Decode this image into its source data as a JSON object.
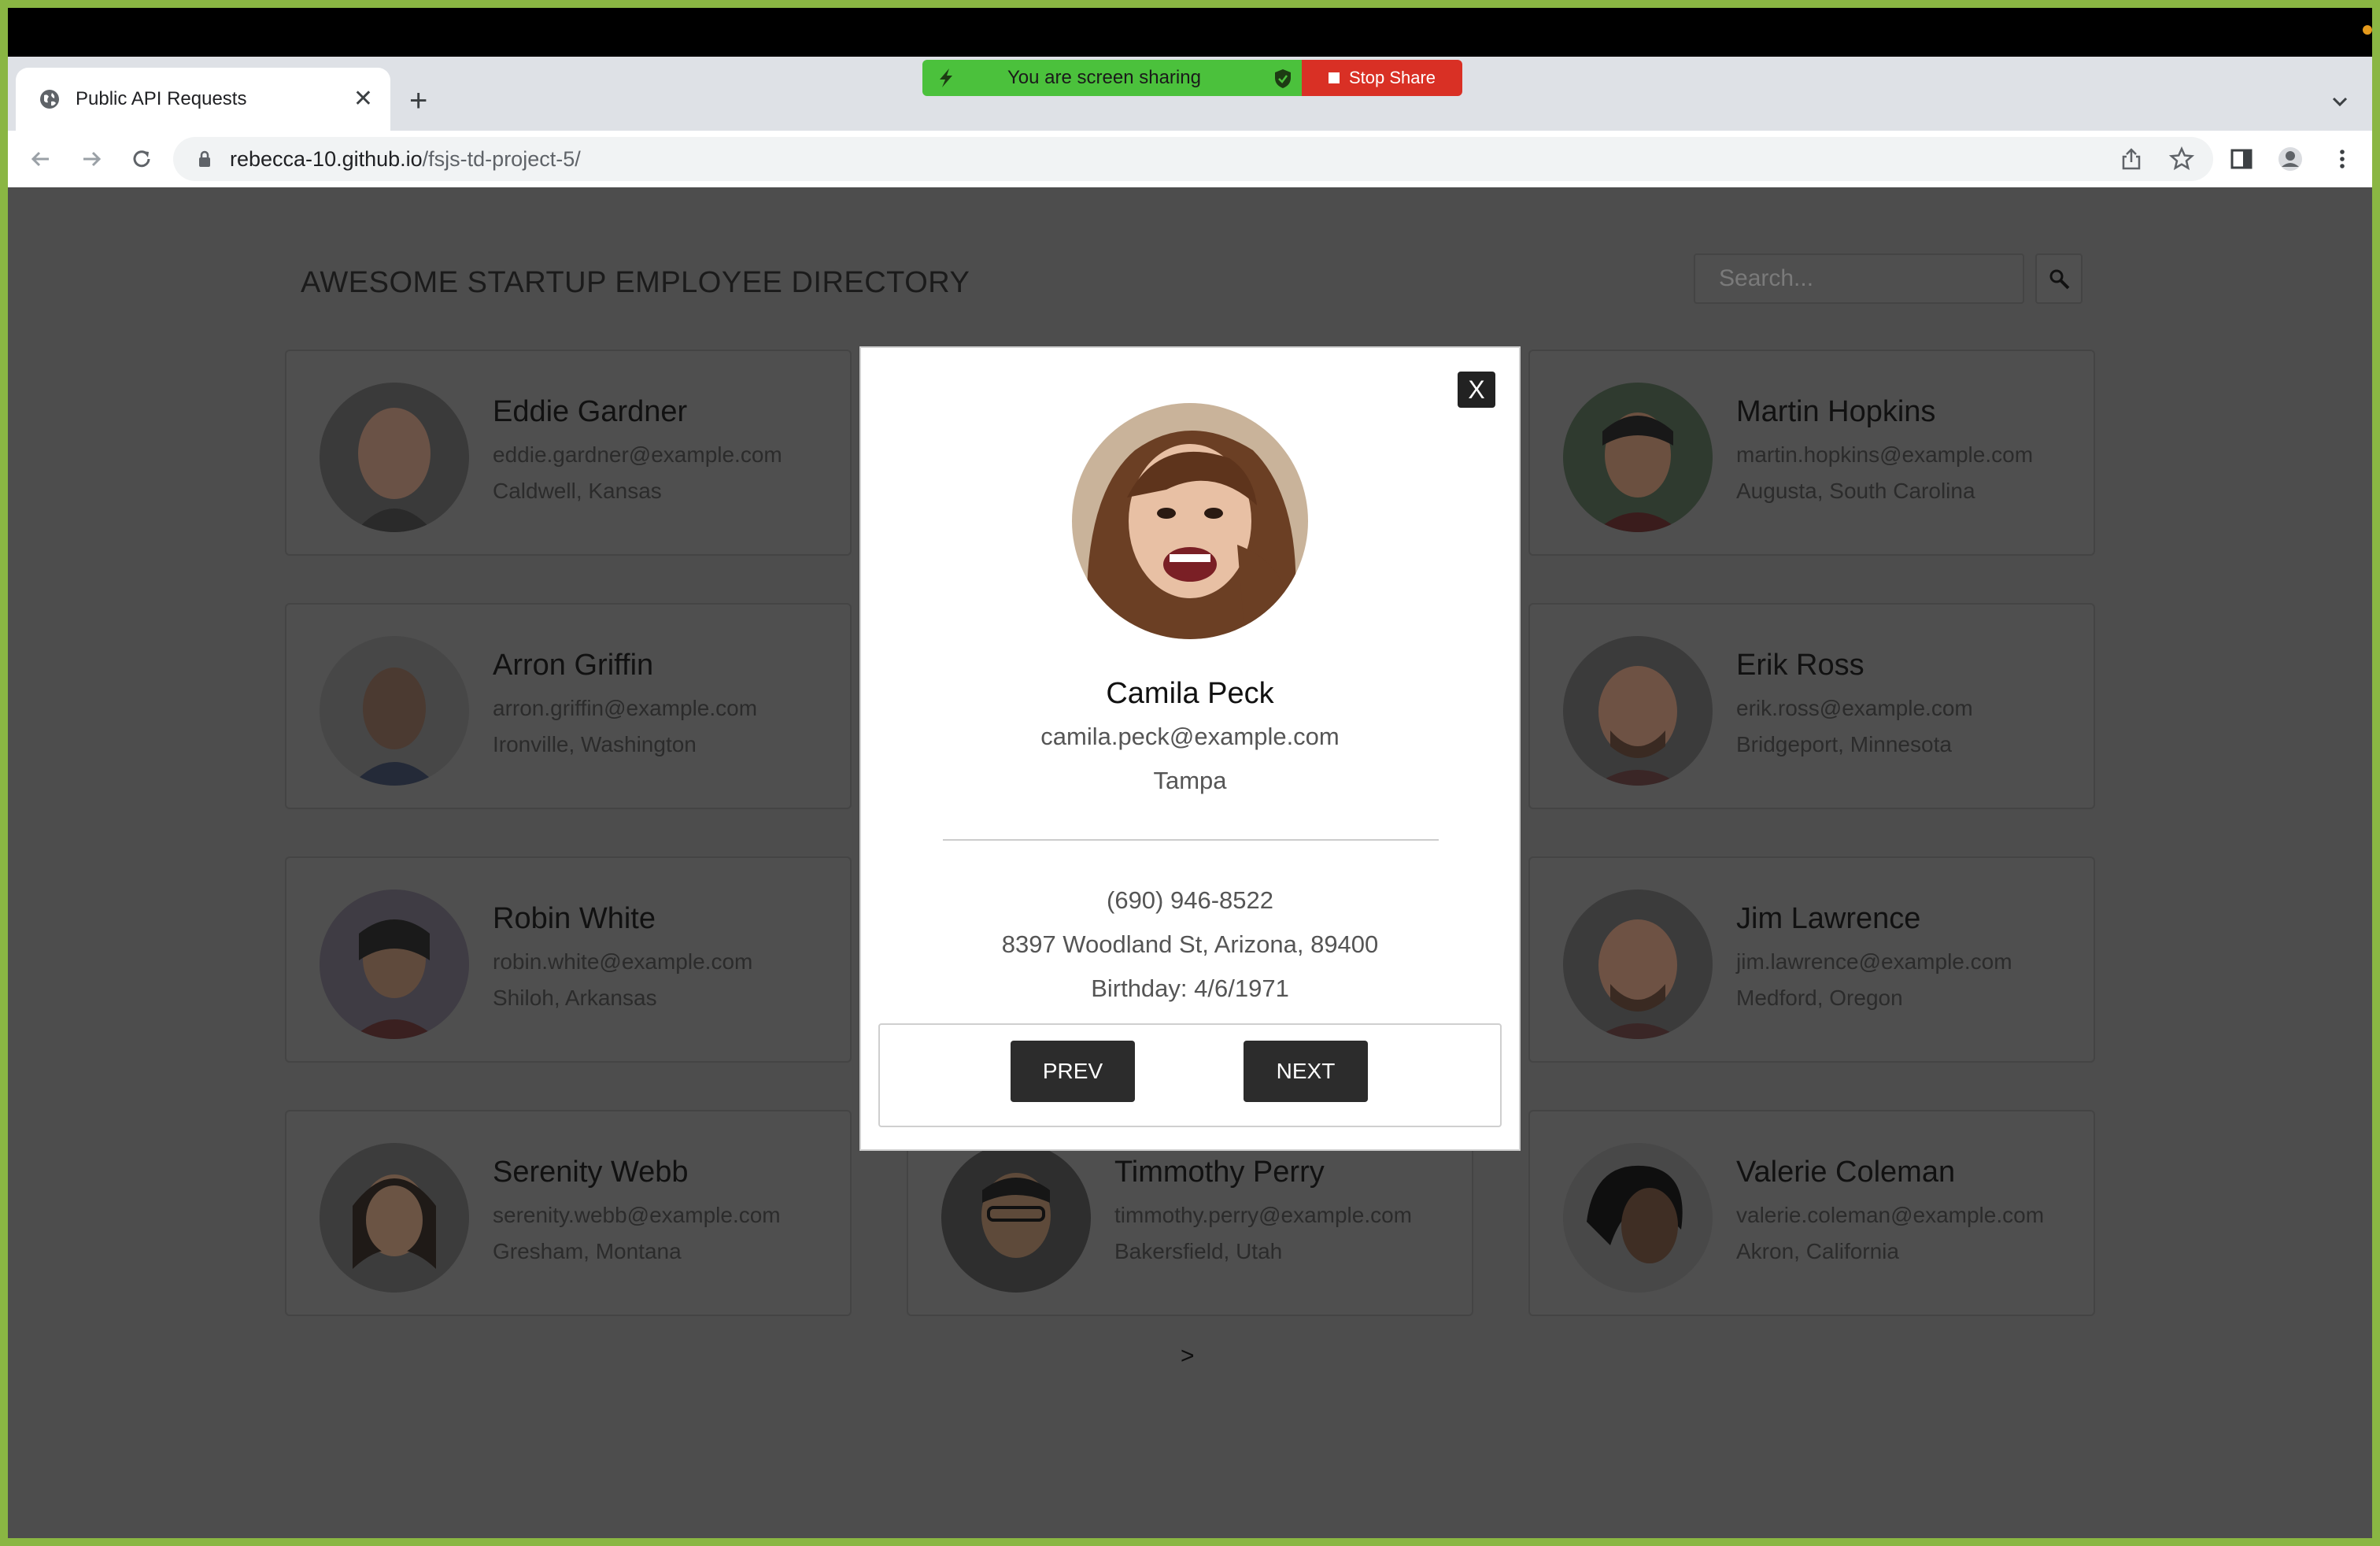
{
  "browser": {
    "tab_title": "Public API Requests",
    "new_tab": "+",
    "tab_close": "✕",
    "url_host": "rebecca-10.github.io",
    "url_path": "/fsjs-td-project-5/"
  },
  "screen_share": {
    "message": "You are screen sharing",
    "stop_label": "Stop Share"
  },
  "page": {
    "title": "AWESOME STARTUP EMPLOYEE DIRECTORY",
    "search_placeholder": "Search...",
    "pager": ">"
  },
  "employees": [
    {
      "name": "Eddie Gardner",
      "email": "eddie.gardner@example.com",
      "location": "Caldwell, Kansas"
    },
    {
      "name": "Martin Hopkins",
      "email": "martin.hopkins@example.com",
      "location": "Augusta, South Carolina"
    },
    {
      "name": "Arron Griffin",
      "email": "arron.griffin@example.com",
      "location": "Ironville, Washington"
    },
    {
      "name": "Erik Ross",
      "email": "erik.ross@example.com",
      "location": "Bridgeport, Minnesota"
    },
    {
      "name": "Robin White",
      "email": "robin.white@example.com",
      "location": "Shiloh, Arkansas"
    },
    {
      "name": "Jim Lawrence",
      "email": "jim.lawrence@example.com",
      "location": "Medford, Oregon"
    },
    {
      "name": "Serenity Webb",
      "email": "serenity.webb@example.com",
      "location": "Gresham, Montana"
    },
    {
      "name": "Timmothy Perry",
      "email": "timmothy.perry@example.com",
      "location": "Bakersfield, Utah"
    },
    {
      "name": "Valerie Coleman",
      "email": "valerie.coleman@example.com",
      "location": "Akron, California"
    }
  ],
  "modal": {
    "close_label": "X",
    "name": "Camila Peck",
    "email": "camila.peck@example.com",
    "city": "Tampa",
    "phone": "(690) 946-8522",
    "address": "8397 Woodland St, Arizona, 89400",
    "birthday": "Birthday: 4/6/1971",
    "prev_label": "PREV",
    "next_label": "NEXT"
  },
  "colors": {
    "share_green": "#4bc13c",
    "stop_red": "#d93025",
    "overlay": "#4d4d4d",
    "modal_button": "#2c2c2c"
  },
  "icons": [
    "globe-icon",
    "close-icon",
    "plus-icon",
    "back-arrow-icon",
    "forward-arrow-icon",
    "reload-icon",
    "lock-icon",
    "share-icon",
    "star-icon",
    "sidebar-icon",
    "profile-icon",
    "kebab-menu-icon",
    "search-icon",
    "chevron-down-icon",
    "lightning-icon",
    "shield-check-icon",
    "stop-icon"
  ]
}
